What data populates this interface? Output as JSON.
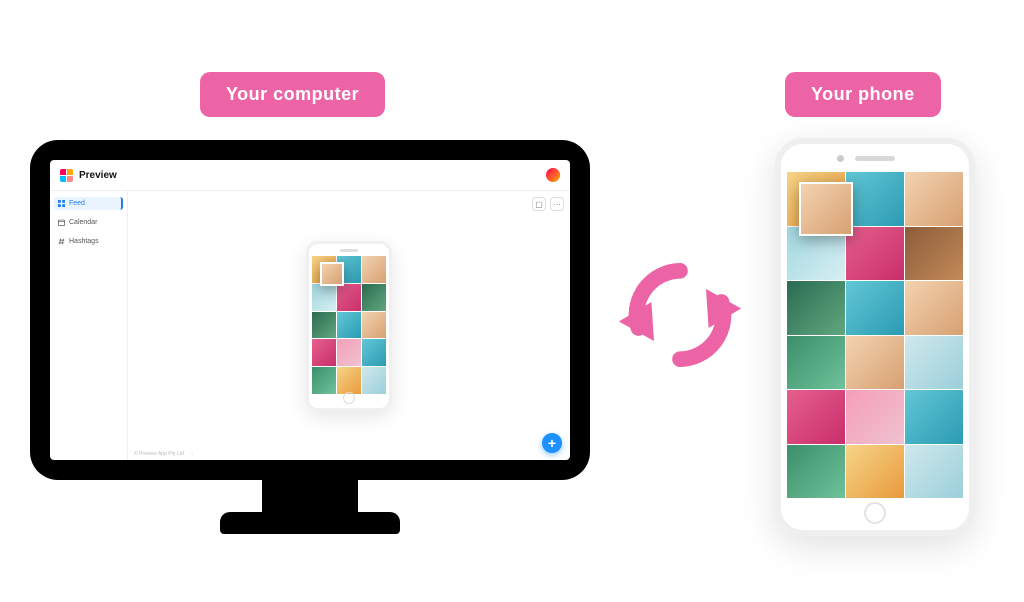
{
  "labels": {
    "computer": "Your computer",
    "phone": "Your phone"
  },
  "app": {
    "title": "Preview",
    "sidebar": {
      "items": [
        {
          "label": "Feed",
          "icon": "grid-icon",
          "active": true
        },
        {
          "label": "Calendar",
          "icon": "calendar-icon",
          "active": false
        },
        {
          "label": "Hashtags",
          "icon": "hashtag-icon",
          "active": false
        }
      ]
    },
    "footer_text": "© Preview App Pty Ltd",
    "fab_label": "+"
  },
  "icons": {
    "phone_chip": "▢",
    "more_chip": "⋯",
    "caret": "‹"
  },
  "colors": {
    "accent_pink": "#ed64a6",
    "accent_blue": "#1e90ff"
  }
}
